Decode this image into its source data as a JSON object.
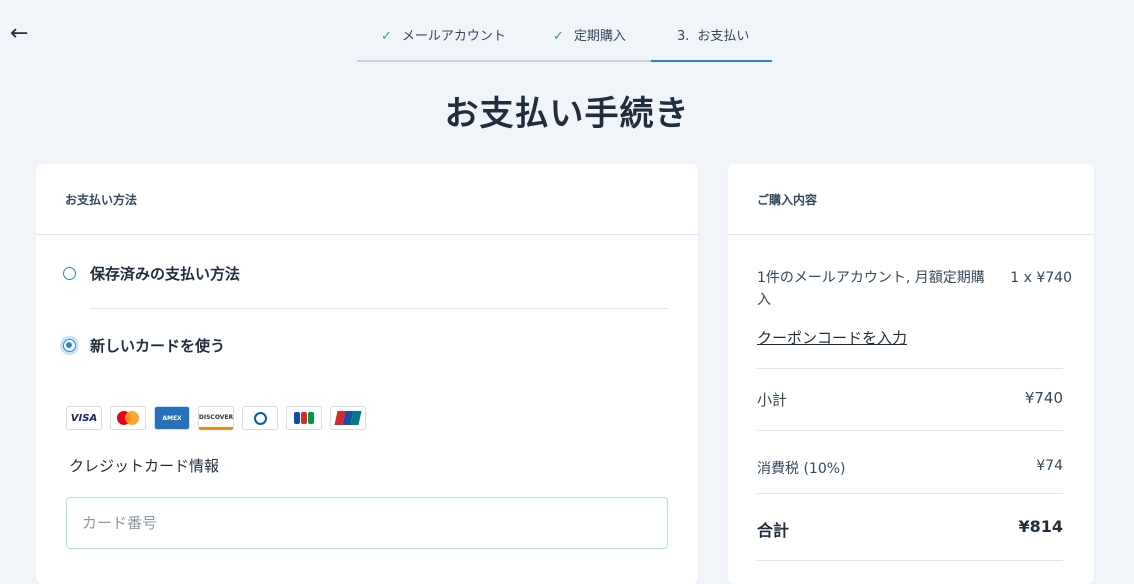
{
  "nav": {
    "back_icon": "←"
  },
  "stepper": {
    "steps": [
      {
        "label": "メールアカウント",
        "state": "done"
      },
      {
        "label": "定期購入",
        "state": "done"
      },
      {
        "number": "3.",
        "label": "お支払い",
        "state": "active"
      }
    ],
    "check_icon": "✓"
  },
  "page_title": "お支払い手続き",
  "payment": {
    "header": "お支払い方法",
    "options": [
      {
        "label": "保存済みの支払い方法",
        "selected": false
      },
      {
        "label": "新しいカードを使う",
        "selected": true
      }
    ],
    "card_brands": [
      "VISA",
      "Mastercard",
      "AMERICAN EXPRESS",
      "DISCOVER",
      "Diners Club",
      "JCB",
      "UnionPay"
    ],
    "card_info_label": "クレジットカード情報",
    "card_number_placeholder": "カード番号"
  },
  "summary": {
    "header": "ご購入内容",
    "item_description": "1件のメールアカウント, 月額定期購入",
    "item_price": "1 x ¥740",
    "coupon_link": "クーポンコードを入力",
    "subtotal_label": "小計",
    "subtotal_value": "¥740",
    "tax_label": "消費税 (10%)",
    "tax_value": "¥74",
    "total_label": "合計",
    "total_value": "¥814"
  },
  "colors": {
    "accent": "#2a84d8",
    "check": "#3aa55d",
    "background": "#f1f5f9"
  }
}
